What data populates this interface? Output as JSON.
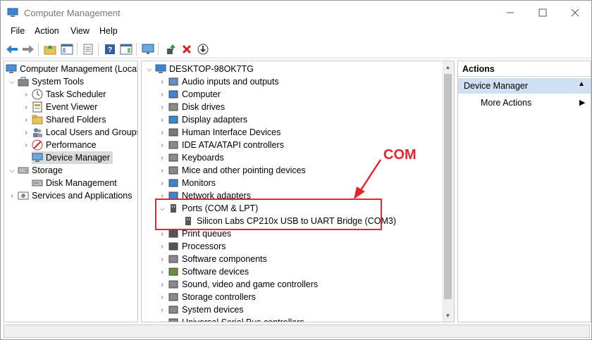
{
  "window": {
    "title": "Computer Management"
  },
  "menu": [
    "File",
    "Action",
    "View",
    "Help"
  ],
  "left_tree": {
    "root": "Computer Management (Local",
    "system_tools": "System Tools",
    "items": [
      "Task Scheduler",
      "Event Viewer",
      "Shared Folders",
      "Local Users and Groups",
      "Performance",
      "Device Manager"
    ],
    "storage": "Storage",
    "disk_management": "Disk Management",
    "services": "Services and Applications"
  },
  "device_tree": {
    "computer": "DESKTOP-98OK7TG",
    "categories_before": [
      "Audio inputs and outputs",
      "Computer",
      "Disk drives",
      "Display adapters",
      "Human Interface Devices",
      "IDE ATA/ATAPI controllers",
      "Keyboards",
      "Mice and other pointing devices",
      "Monitors",
      "Network adapters"
    ],
    "ports": "Ports (COM & LPT)",
    "port_device": "Silicon Labs CP210x USB to UART Bridge (COM3)",
    "categories_after": [
      "Print queues",
      "Processors",
      "Software components",
      "Software devices",
      "Sound, video and game controllers",
      "Storage controllers",
      "System devices",
      "Universal Serial Bus controllers"
    ]
  },
  "actions": {
    "header": "Actions",
    "group": "Device Manager",
    "more": "More Actions"
  },
  "annotation": {
    "label": "COM",
    "color": "#e8242c"
  },
  "colors": {
    "selection": "#d9d9d9",
    "actions_group": "#cfe0f3"
  }
}
